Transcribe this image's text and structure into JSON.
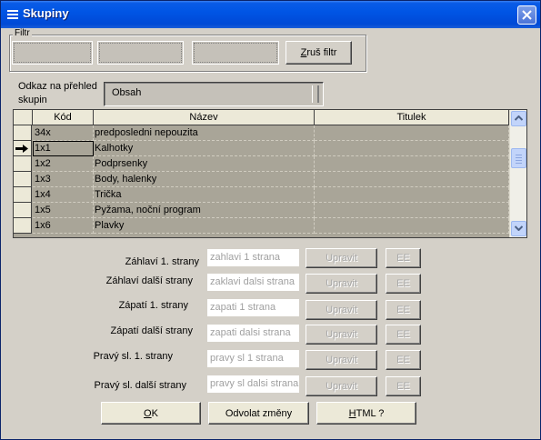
{
  "window": {
    "title": "Skupiny",
    "menu_icon": "menu-icon",
    "close_icon": "close-icon"
  },
  "filter": {
    "legend": "Filtr",
    "fields": [
      "",
      "",
      ""
    ],
    "clear_button": {
      "label": "Zruš filtr",
      "accel": "Z",
      "rest": "ruš filtr"
    }
  },
  "link": {
    "label": "Odkaz na přehled skupin",
    "value": "Obsah"
  },
  "table": {
    "columns": [
      "Kód",
      "Název",
      "Titulek"
    ],
    "current_row_icon": "record-pointer-icon",
    "rows": [
      {
        "kod": "34x",
        "nazev": "predposledni nepouzita",
        "titulek": ""
      },
      {
        "kod": "1x1",
        "nazev": "Kalhotky",
        "titulek": ""
      },
      {
        "kod": "1x2",
        "nazev": "Podprsenky",
        "titulek": ""
      },
      {
        "kod": "1x3",
        "nazev": "Body, halenky",
        "titulek": ""
      },
      {
        "kod": "1x4",
        "nazev": "Trička",
        "titulek": ""
      },
      {
        "kod": "1x5",
        "nazev": "Pyžama, noční program",
        "titulek": ""
      },
      {
        "kod": "1x6",
        "nazev": "Plavky",
        "titulek": ""
      }
    ],
    "current_row_index": 1,
    "scrollbar": {
      "up_icon": "scroll-up-icon",
      "down_icon": "scroll-down-icon"
    }
  },
  "headers_footers": {
    "edit_label": "Upravit",
    "ee_label": "EE",
    "rows": [
      {
        "label": "Záhlaví 1. strany",
        "value": "zahlavi 1 strana"
      },
      {
        "label": "Záhlaví další strany",
        "value": "zaklavi dalsi strana"
      },
      {
        "label": "Zápatí 1. strany",
        "value": "zapati 1 strana"
      },
      {
        "label": "Zápatí další strany",
        "value": "zapati dalsi strana"
      },
      {
        "label": "Pravý sl. 1. strany",
        "value": "pravy sl 1 strana"
      },
      {
        "label": "Pravý sl. další strany",
        "value": "pravy sl dalsi strana"
      }
    ]
  },
  "footer": {
    "ok": {
      "label": "OK",
      "accel": "O",
      "rest": "K"
    },
    "cancel": {
      "label": "Odvolat změny",
      "accel": "",
      "rest": "Odvolat změny"
    },
    "html": {
      "label": "HTML ?",
      "accel": "H",
      "rest": "TML ?"
    }
  },
  "colors": {
    "titlebar": "#0055e5",
    "dialog_bg": "#d4d0c8",
    "grid_bg": "#a9a598",
    "header_bg": "#ece9d8"
  }
}
